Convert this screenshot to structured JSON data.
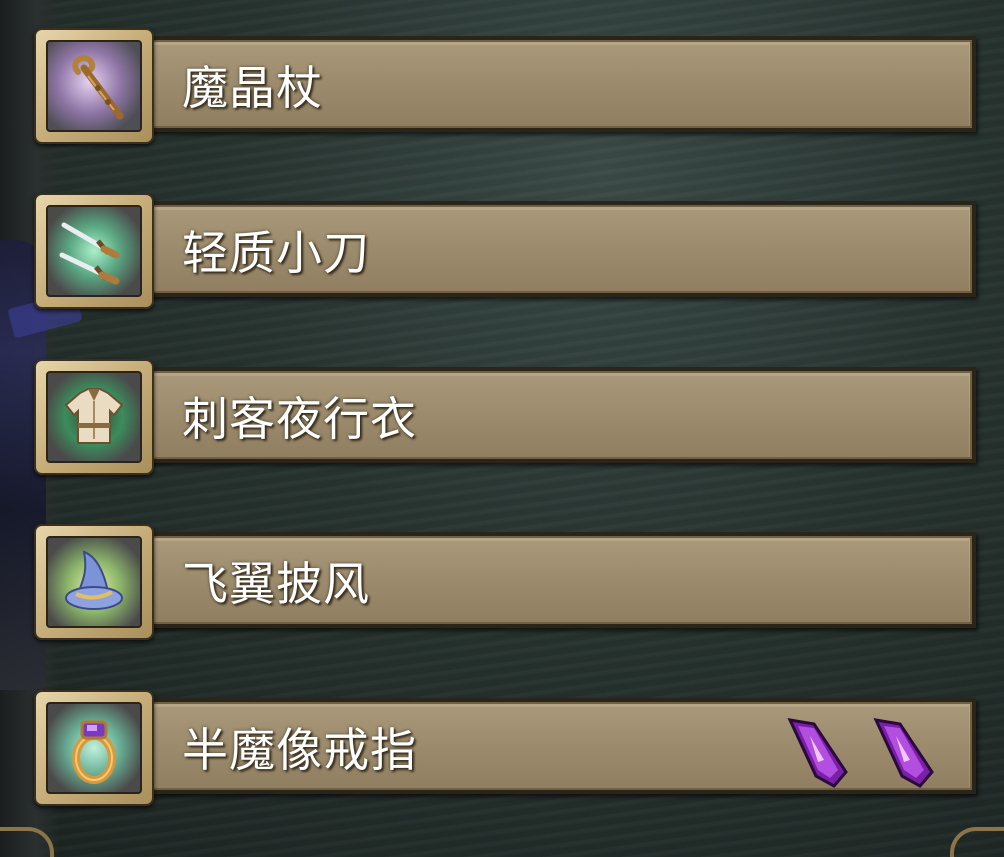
{
  "items": [
    {
      "name": "魔晶杖",
      "icon": "staff-icon",
      "glow": "#c9a6e6"
    },
    {
      "name": "轻质小刀",
      "icon": "daggers-icon",
      "glow": "#7fe0b0"
    },
    {
      "name": "刺客夜行衣",
      "icon": "armor-icon",
      "glow": "#5fd08a"
    },
    {
      "name": "飞翼披风",
      "icon": "wizard-hat-icon",
      "glow": "#b8e06a"
    },
    {
      "name": "半魔像戒指",
      "icon": "ring-icon",
      "glow": "#9fe0c6",
      "gems": [
        "purple-gem-icon",
        "purple-gem-icon"
      ]
    }
  ],
  "colors": {
    "bar": "#9d8c6d",
    "frame": "#c6ad79",
    "gem": "#a020d0",
    "text": "#ffffff"
  }
}
